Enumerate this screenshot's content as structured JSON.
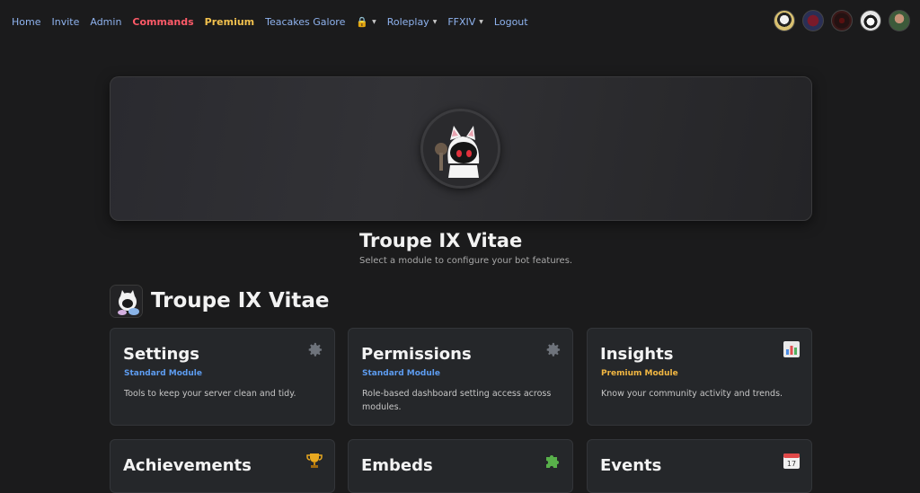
{
  "nav": {
    "links": {
      "home": "Home",
      "invite": "Invite",
      "admin": "Admin",
      "commands": "Commands",
      "premium": "Premium",
      "teacakes": "Teacakes Galore",
      "roleplay": "Roleplay",
      "ffxiv": "FFXIV",
      "logout": "Logout"
    },
    "avatar_count": 5
  },
  "header": {
    "title": "Troupe IX Vitae",
    "subtitle": "Select a module to configure your bot features."
  },
  "section": {
    "title": "Troupe IX Vitae"
  },
  "modules": [
    {
      "title": "Settings",
      "tier": "Standard Module",
      "desc": "Tools to keep your server clean and tidy.",
      "icon": "gear-icon"
    },
    {
      "title": "Permissions",
      "tier": "Standard Module",
      "desc": "Role-based dashboard setting access across modules.",
      "icon": "gear-icon"
    },
    {
      "title": "Insights",
      "tier": "Premium Module",
      "desc": "Know your community activity and trends.",
      "icon": "bar-chart-icon"
    },
    {
      "title": "Achievements",
      "icon": "trophy-icon"
    },
    {
      "title": "Embeds",
      "icon": "puzzle-icon"
    },
    {
      "title": "Events",
      "icon": "calendar-icon"
    }
  ],
  "colors": {
    "background": "#1b1b1c",
    "card": "#25272a",
    "link": "#8fb3ef",
    "commands": "#ff5a68",
    "premium": "#f2c14e",
    "standard_tier": "#5d9cf0",
    "premium_tier": "#f2b742"
  }
}
